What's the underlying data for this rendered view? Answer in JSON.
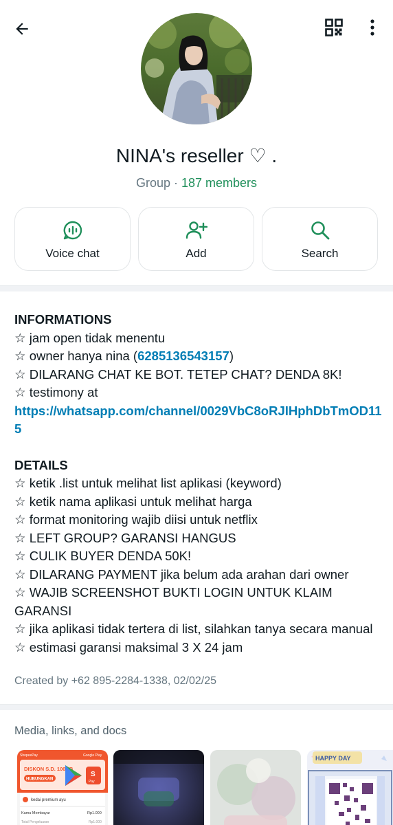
{
  "header": {
    "back_icon": "arrow-left-icon",
    "qr_icon": "qr-code-icon",
    "more_icon": "more-vertical-icon"
  },
  "group": {
    "name": "NINA's reseller  ♡ .",
    "type": "Group",
    "separator": " · ",
    "members": "187 members"
  },
  "actions": [
    {
      "label": "Voice chat",
      "icon": "voice-chat-icon"
    },
    {
      "label": "Add",
      "icon": "add-person-icon"
    },
    {
      "label": "Search",
      "icon": "search-icon"
    }
  ],
  "description": {
    "info_heading": "INFORMATIONS",
    "info_1": "☆ jam open tidak menentu",
    "info_2_prefix": "☆ owner hanya nina (",
    "info_2_phone": "6285136543157",
    "info_2_suffix": ")",
    "info_3": "☆ DILARANG CHAT KE BOT. TETEP CHAT? DENDA 8K!",
    "info_4": "☆ testimony at",
    "info_link": "https://whatsapp.com/channel/0029VbC8oRJIHphDbTmOD115",
    "details_heading": "DETAILS",
    "details": [
      "☆ ketik .list untuk melihat list aplikasi (keyword)",
      "☆ ketik nama aplikasi untuk melihat harga",
      "☆ format monitoring wajib diisi untuk netflix",
      "☆ LEFT GROUP? GARANSI HANGUS",
      "☆ CULIK BUYER DENDA 50K!",
      "☆ DILARANG PAYMENT jika belum ada arahan dari owner",
      "☆ WAJIB SCREENSHOT BUKTI LOGIN UNTUK KLAIM GARANSI",
      "☆ jika aplikasi tidak tertera di list, silahkan tanya secara manual",
      "☆ estimasi garansi maksimal 3 X 24 jam"
    ],
    "created_by": "Created by +62 895-2284-1338, 02/02/25"
  },
  "media": {
    "title": "Media, links, and docs",
    "thumb1": {
      "banner": "DISKON S.D. 100RB",
      "button": "HUBUNGKAN",
      "shop": "kedai premium ayu",
      "row1_label": "Kamu Membayar",
      "row1_value": "Rp1.000",
      "row2_label": "Total Pengeluaran",
      "row2_value": "Rp1.000",
      "top_left": "ShopeePay",
      "top_right": "Google Play"
    },
    "thumb4_sign": "HAPPY DAY"
  },
  "colors": {
    "accent_green": "#1f8f5a",
    "link_blue": "#027eb5",
    "text_primary": "#111b21",
    "text_secondary": "#667781"
  }
}
